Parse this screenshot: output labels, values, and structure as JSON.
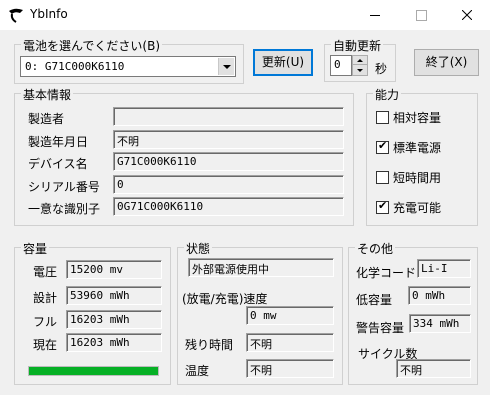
{
  "window": {
    "title": "YbInfo"
  },
  "battery_select": {
    "legend": "電池を選んでください(B)",
    "value": "0: G71C000K6110"
  },
  "update_button": "更新(U)",
  "auto_update": {
    "legend": "自動更新",
    "value": "0",
    "unit": "秒"
  },
  "exit_button": "終了(X)",
  "basic_info": {
    "legend": "基本情報",
    "rows": [
      {
        "label": "製造者",
        "value": ""
      },
      {
        "label": "製造年月日",
        "value": "不明"
      },
      {
        "label": "デバイス名",
        "value": "G71C000K6110"
      },
      {
        "label": "シリアル番号",
        "value": "0"
      },
      {
        "label": "一意な識別子",
        "value": "0G71C000K6110"
      }
    ]
  },
  "capability": {
    "legend": "能力",
    "items": [
      {
        "label": "相対容量",
        "checked": false
      },
      {
        "label": "標準電源",
        "checked": true
      },
      {
        "label": "短時間用",
        "checked": false
      },
      {
        "label": "充電可能",
        "checked": true
      }
    ]
  },
  "capacity": {
    "legend": "容量",
    "rows": [
      {
        "label": "電圧",
        "value": "15200 mv"
      },
      {
        "label": "設計",
        "value": "53960 mWh"
      },
      {
        "label": "フル",
        "value": "16203 mWh"
      },
      {
        "label": "現在",
        "value": "16203 mWh"
      }
    ],
    "progress_percent": 100,
    "progress_color": "#06b025"
  },
  "status": {
    "legend": "状態",
    "power_state": "外部電源使用中",
    "rate_label": "(放電/充電)速度",
    "rate_value": "0 mw",
    "remaining_label": "残り時間",
    "remaining_value": "不明",
    "temp_label": "温度",
    "temp_value": "不明"
  },
  "other": {
    "legend": "その他",
    "chem_label": "化学コード",
    "chem_value": "Li-I",
    "low_label": "低容量",
    "low_value": "0 mWh",
    "warn_label": "警告容量",
    "warn_value": "334 mWh",
    "cycle_label": "サイクル数",
    "cycle_value": "不明"
  }
}
